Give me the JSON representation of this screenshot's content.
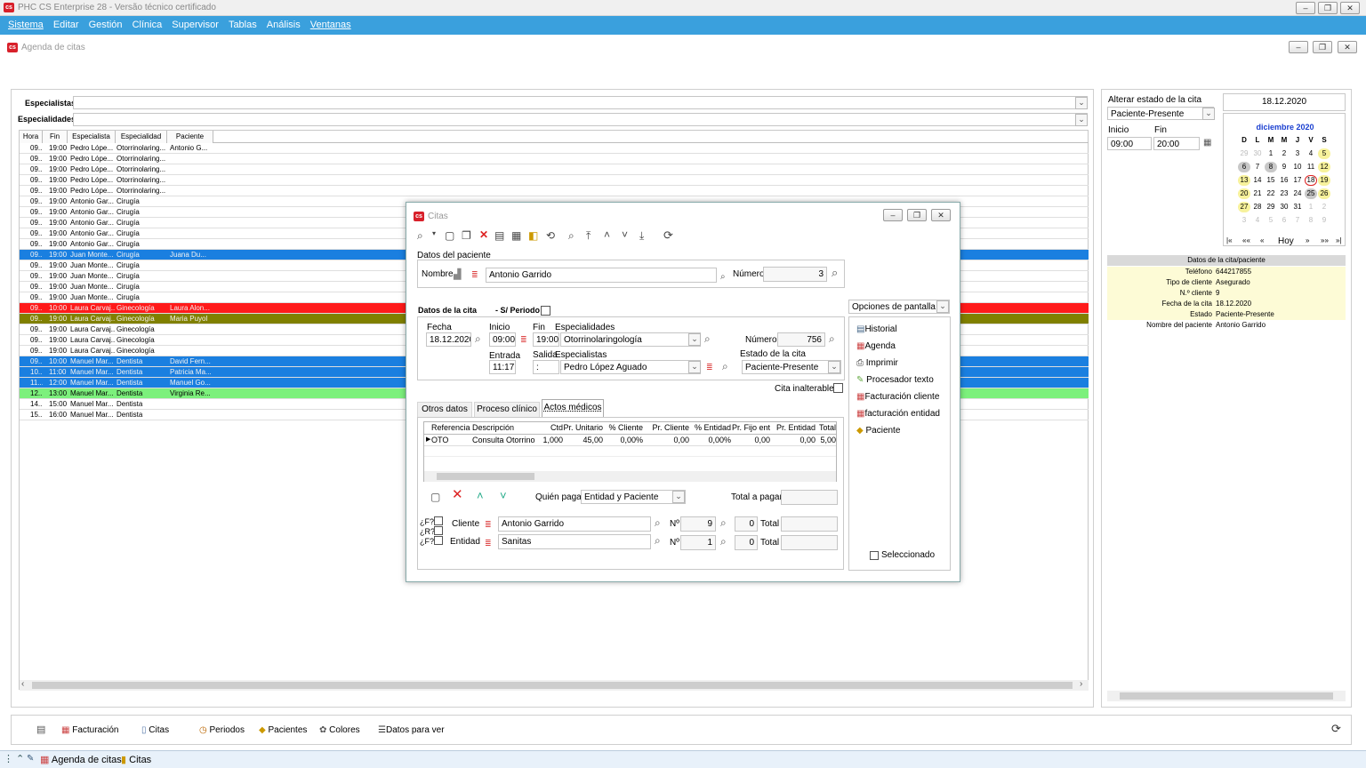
{
  "app": {
    "title": "PHC CS Enterprise 28 - Versão técnico certificado"
  },
  "menu": [
    "Sistema",
    "Editar",
    "Gestión",
    "Clínica",
    "Supervisor",
    "Tablas",
    "Análisis",
    "Ventanas"
  ],
  "window": {
    "title": "Agenda de citas"
  },
  "filters": {
    "especialistas_label": "Especialistas",
    "especialidades_label": "Especialidades"
  },
  "grid": {
    "columns": [
      "Hora",
      "Fin",
      "Especialista",
      "Especialidad",
      "Paciente"
    ],
    "rows": [
      [
        "09...",
        "19:00",
        "Pedro Lópe...",
        "Otorrinolaring...",
        "Antonio G..."
      ],
      [
        "09...",
        "19:00",
        "Pedro Lópe...",
        "Otorrinolaring...",
        ""
      ],
      [
        "09...",
        "19:00",
        "Pedro Lópe...",
        "Otorrinolaring...",
        ""
      ],
      [
        "09...",
        "19:00",
        "Pedro Lópe...",
        "Otorrinolaring...",
        ""
      ],
      [
        "09...",
        "19:00",
        "Pedro Lópe...",
        "Otorrinolaring...",
        ""
      ],
      [
        "09...",
        "19:00",
        "Antonio Gar...",
        "Cirugía",
        ""
      ],
      [
        "09...",
        "19:00",
        "Antonio Gar...",
        "Cirugía",
        ""
      ],
      [
        "09...",
        "19:00",
        "Antonio Gar...",
        "Cirugía",
        ""
      ],
      [
        "09...",
        "19:00",
        "Antonio Gar...",
        "Cirugía",
        ""
      ],
      [
        "09...",
        "19:00",
        "Antonio Gar...",
        "Cirugía",
        ""
      ],
      [
        "09...",
        "19:00",
        "Juan Monte...",
        "Cirugía",
        "Juana Du..."
      ],
      [
        "09...",
        "19:00",
        "Juan Monte...",
        "Cirugía",
        ""
      ],
      [
        "09...",
        "19:00",
        "Juan Monte...",
        "Cirugía",
        ""
      ],
      [
        "09...",
        "19:00",
        "Juan Monte...",
        "Cirugía",
        ""
      ],
      [
        "09...",
        "19:00",
        "Juan Monte...",
        "Cirugía",
        ""
      ],
      [
        "09...",
        "10:00",
        "Laura Carvaj...",
        "Ginecología",
        "Laura Alon..."
      ],
      [
        "09...",
        "19:00",
        "Laura Carvaj...",
        "Ginecología",
        "Maria Puyol"
      ],
      [
        "09...",
        "19:00",
        "Laura Carvaj...",
        "Ginecología",
        ""
      ],
      [
        "09...",
        "19:00",
        "Laura Carvaj...",
        "Ginecología",
        ""
      ],
      [
        "09...",
        "19:00",
        "Laura Carvaj...",
        "Ginecología",
        ""
      ],
      [
        "09...",
        "10:00",
        "Manuel Mar...",
        "Dentista",
        "David Fern..."
      ],
      [
        "10...",
        "11:00",
        "Manuel Mar...",
        "Dentista",
        "Patricia Ma..."
      ],
      [
        "11...",
        "12:00",
        "Manuel Mar...",
        "Dentista",
        "Manuel Go..."
      ],
      [
        "12...",
        "13:00",
        "Manuel Mar...",
        "Dentista",
        "Virginia Re..."
      ],
      [
        "14...",
        "15:00",
        "Manuel Mar...",
        "Dentista",
        ""
      ],
      [
        "15...",
        "16:00",
        "Manuel Mar...",
        "Dentista",
        ""
      ]
    ],
    "row_colors": [
      "",
      "",
      "",
      "",
      "",
      "",
      "",
      "",
      "",
      "",
      "#1a7fe0",
      "",
      "",
      "",
      "",
      "#ff1a1a",
      "#808000",
      "",
      "",
      "",
      "#1a7fe0",
      "#1a7fe0",
      "#1a7fe0",
      "#7cf07c",
      "",
      ""
    ]
  },
  "estado": {
    "label": "Alterar estado de la cita",
    "value": "Paciente-Presente",
    "inicio_label": "Inicio",
    "fin_label": "Fin",
    "inicio": "09:00",
    "fin": "20:00"
  },
  "calendar": {
    "date": "18.12.2020",
    "month": "diciembre 2020",
    "weekdays": [
      "D",
      "L",
      "M",
      "M",
      "J",
      "V",
      "S"
    ],
    "weeks": [
      [
        "29",
        "30",
        "1",
        "2",
        "3",
        "4",
        "5"
      ],
      [
        "6",
        "7",
        "8",
        "9",
        "10",
        "11",
        "12"
      ],
      [
        "13",
        "14",
        "15",
        "16",
        "17",
        "18",
        "19"
      ],
      [
        "20",
        "21",
        "22",
        "23",
        "24",
        "25",
        "26"
      ],
      [
        "27",
        "28",
        "29",
        "30",
        "31",
        "1",
        "2"
      ],
      [
        "3",
        "4",
        "5",
        "6",
        "7",
        "8",
        "9"
      ]
    ],
    "nav": [
      "|«",
      "««",
      "«",
      "Hoy",
      "»",
      "»»",
      "»|"
    ]
  },
  "details": {
    "header": "Datos de la cita/paciente",
    "rows": [
      [
        "Teléfono",
        "644217855"
      ],
      [
        "Tipo de cliente",
        "Asegurado"
      ],
      [
        "N.º cliente",
        "9"
      ],
      [
        "Fecha de la cita",
        "18.12.2020"
      ],
      [
        "Estado",
        "Paciente-Presente"
      ],
      [
        "Nombre del paciente",
        "Antonio Garrido"
      ]
    ]
  },
  "bottom": [
    "Facturación",
    "Citas",
    "Periodos",
    "Pacientes",
    "Colores",
    "Datos para ver"
  ],
  "taskbar": [
    "Agenda de citas",
    "Citas"
  ],
  "dialog": {
    "title": "Citas",
    "paciente": {
      "section": "Datos del paciente",
      "nombre_label": "Nombre",
      "nombre": "Antonio Garrido",
      "numero_label": "Número",
      "numero": "3"
    },
    "cita": {
      "section": "Datos de la cita",
      "periodo_label": "- S/ Periodo",
      "fecha_label": "Fecha",
      "fecha": "18.12.2020",
      "inicio_label": "Inicio",
      "inicio": "09:00",
      "fin_label": "Fin",
      "fin": "19:00",
      "especialidades_label": "Especialidades",
      "especialidad": "Otorrinolaringología",
      "numero_label": "Número",
      "numero": "756",
      "entrada_label": "Entrada",
      "entrada": "11:17",
      "salida_label": "Salida",
      "salida": ":",
      "especialistas_label": "Especialistas",
      "especialista": "Pedro López Aguado",
      "estado_label": "Estado de la cita",
      "estado": "Paciente-Presente",
      "inalterable_label": "Cita inalterable"
    },
    "tabs": [
      "Otros datos",
      "Proceso clínico",
      "Actos médicos"
    ],
    "acts": {
      "columns": [
        "Referencia",
        "Descripción",
        "Ctd",
        "Pr. Unitario",
        "% Cliente",
        "Pr. Cliente",
        "% Entidad",
        "Pr. Fijo ent",
        "Pr. Entidad",
        "Total"
      ],
      "row": [
        "OTO",
        "Consulta Otorrino",
        "1,000",
        "45,00",
        "0,00%",
        "0,00",
        "0,00%",
        "0,00",
        "0,00",
        "5,00"
      ]
    },
    "quien_label": "Quién paga",
    "quien": "Entidad y Paciente",
    "total_pagar_label": "Total a pagar",
    "cliente": {
      "label": "Cliente",
      "value": "Antonio Garrido",
      "n_label": "Nº",
      "n": "9",
      "n2": "0",
      "total_label": "Total"
    },
    "entidad": {
      "label": "Entidad",
      "value": "Sanitas",
      "n_label": "Nº",
      "n": "1",
      "n2": "0",
      "total_label": "Total"
    },
    "fr": [
      "¿F?",
      "¿R?",
      "¿F?"
    ],
    "opciones": {
      "label": "Opciones de pantalla",
      "items": [
        "Historial",
        "Agenda",
        "Imprimir",
        "Procesador texto",
        "Facturación cliente",
        "facturación entidad",
        "Paciente"
      ],
      "seleccionado": "Seleccionado"
    }
  }
}
